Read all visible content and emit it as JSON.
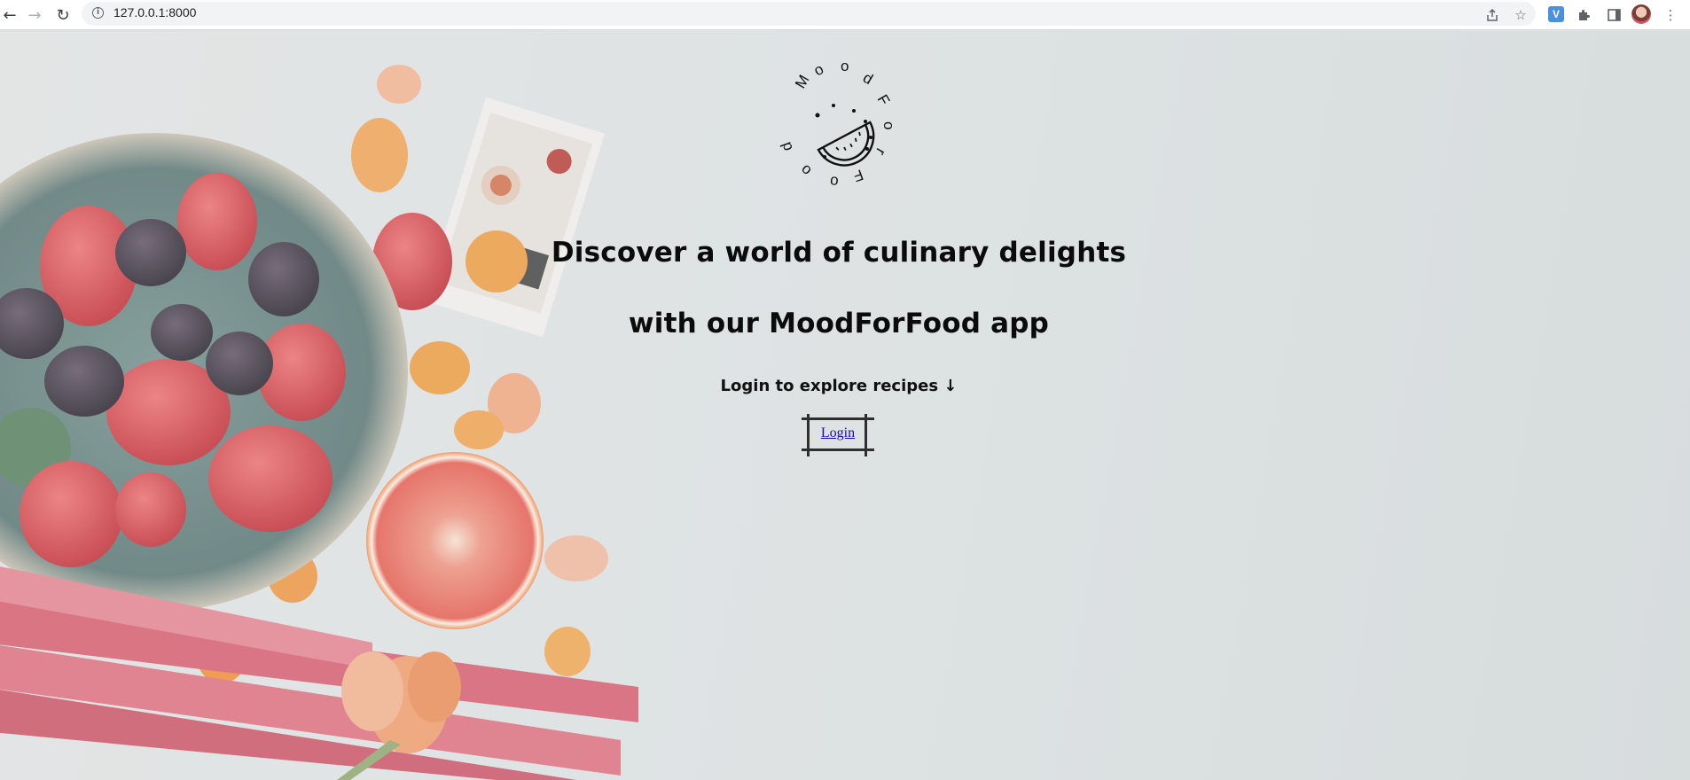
{
  "browser": {
    "url": "127.0.0.1:8000",
    "icons": [
      "back-arrow-icon",
      "forward-arrow-icon",
      "reload-icon",
      "site-info-icon",
      "share-icon",
      "bookmark-star-icon",
      "extension-v-icon",
      "puzzle-extensions-icon",
      "side-panel-icon",
      "profile-avatar",
      "menu-dots-icon"
    ],
    "extension_letter": "V"
  },
  "logo": {
    "ring_text": "MoodForFood"
  },
  "hero": {
    "heading_line1": "Discover a world of culinary delights",
    "heading_line2": "with our MoodForFood app",
    "subtitle": "Login to explore recipes ↓",
    "login_label": "Login"
  },
  "colors": {
    "page_background": "#dfe3e4",
    "heading_text": "#0b0b0b",
    "link": "#1a0dab",
    "login_frame": "#2f2f2f"
  }
}
